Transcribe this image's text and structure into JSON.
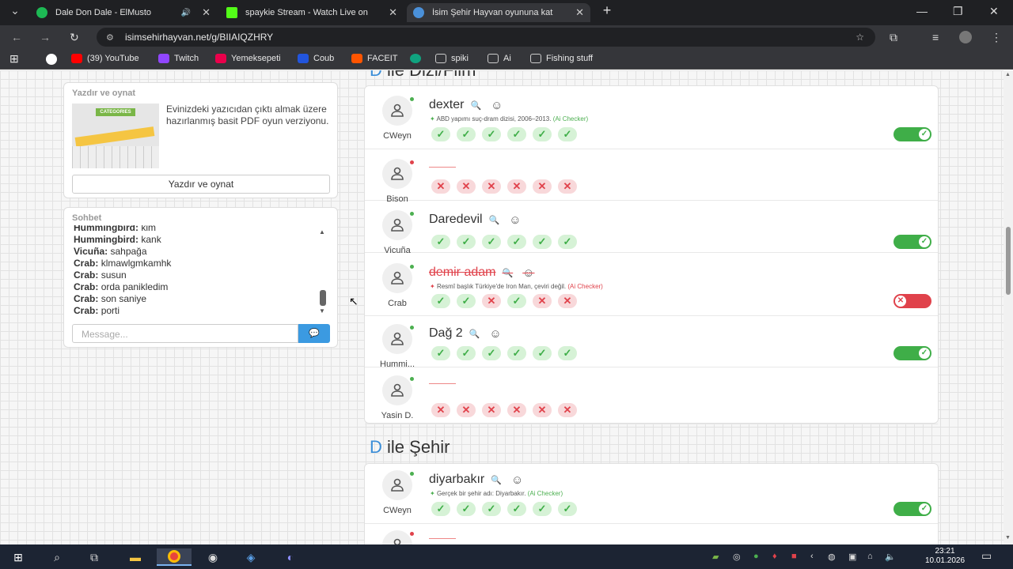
{
  "tabs": [
    {
      "title": "Dale Don Dale - ElMusto",
      "color": "#1db954",
      "audio": "🔊"
    },
    {
      "title": "spaykie Stream - Watch Live on",
      "color": "#53fc18"
    },
    {
      "title": "İsim Şehir Hayvan oyununa kat",
      "color": "#4a90d9"
    }
  ],
  "address": "isimsehirhayvan.net/g/BIIAIQZHRY",
  "bookmarks": [
    {
      "label": "(39) YouTube",
      "color": "#ff0000"
    },
    {
      "label": "Twitch",
      "color": "#9146ff"
    },
    {
      "label": "Yemeksepeti",
      "color": "#ea004b"
    },
    {
      "label": "Coub",
      "color": "#2255dd"
    },
    {
      "label": "FACEIT",
      "color": "#ff5500"
    },
    {
      "label": "spiki",
      "color": "#999"
    },
    {
      "label": "Ai",
      "color": "#999"
    },
    {
      "label": "Fishing stuff",
      "color": "#999"
    }
  ],
  "print": {
    "title": "Yazdır ve oynat",
    "desc": "Evinizdeki yazıcıdan çıktı almak üzere hazırlanmış basit PDF oyun verziyonu.",
    "button": "Yazdır ve oynat",
    "image_text": "CATEGORIES"
  },
  "chat": {
    "title": "Sohbet",
    "placeholder": "Message...",
    "lines": [
      {
        "user": "Hummingbird:",
        "msg": "kim"
      },
      {
        "user": "Hummingbird:",
        "msg": "kank"
      },
      {
        "user": "Vicuña:",
        "msg": "sahpağa"
      },
      {
        "user": "Crab:",
        "msg": "klmawlgmkamhk"
      },
      {
        "user": "Crab:",
        "msg": "susun"
      },
      {
        "user": "Crab:",
        "msg": "orda panikledim"
      },
      {
        "user": "Crab:",
        "msg": "son saniye"
      },
      {
        "user": "Crab:",
        "msg": "porti"
      }
    ]
  },
  "sections": [
    {
      "letter": "D",
      "title": "ile Dizi/Film",
      "rows": [
        {
          "user": "CWeyn",
          "word": "dexter",
          "online": true,
          "hint": "ABD yapımı suç-dram dizisi, 2006–2013.",
          "hint_tag": "(Ai Checker)",
          "hint_ok": true,
          "votes": [
            "ok",
            "ok",
            "ok",
            "ok",
            "ok",
            "ok"
          ],
          "toggle": "on"
        },
        {
          "user": "Bison",
          "word": "",
          "online": false,
          "votes": [
            "no",
            "no",
            "no",
            "no",
            "no",
            "no"
          ]
        },
        {
          "user": "Vicuña",
          "word": "Daredevil",
          "online": true,
          "votes": [
            "ok",
            "ok",
            "ok",
            "ok",
            "ok",
            "ok"
          ],
          "toggle": "on"
        },
        {
          "user": "Crab",
          "word": "demir adam",
          "online": true,
          "invalid": true,
          "hint": "Resmî başlık Türkiye'de Iron Man, çeviri değil.",
          "hint_tag": "(Ai Checker)",
          "hint_ok": false,
          "votes": [
            "ok",
            "ok",
            "no",
            "ok",
            "no",
            "no"
          ],
          "toggle": "off"
        },
        {
          "user": "Hummi...",
          "word": "Dağ 2",
          "online": true,
          "votes": [
            "ok",
            "ok",
            "ok",
            "ok",
            "ok",
            "ok"
          ],
          "toggle": "on"
        },
        {
          "user": "Yasin D.",
          "word": "",
          "online": true,
          "votes": [
            "no",
            "no",
            "no",
            "no",
            "no",
            "no"
          ]
        }
      ]
    },
    {
      "letter": "D",
      "title": "ile Şehir",
      "rows": [
        {
          "user": "CWeyn",
          "word": "diyarbakır",
          "online": true,
          "hint": "Gerçek bir şehir adı: Diyarbakır.",
          "hint_tag": "(Ai Checker)",
          "hint_ok": true,
          "votes": [
            "ok",
            "ok",
            "ok",
            "ok",
            "ok",
            "ok"
          ],
          "toggle": "on"
        },
        {
          "user": "",
          "word": "",
          "online": false,
          "votes": []
        }
      ]
    }
  ],
  "clock": {
    "time": "23:21",
    "date": "10.01.2026"
  }
}
